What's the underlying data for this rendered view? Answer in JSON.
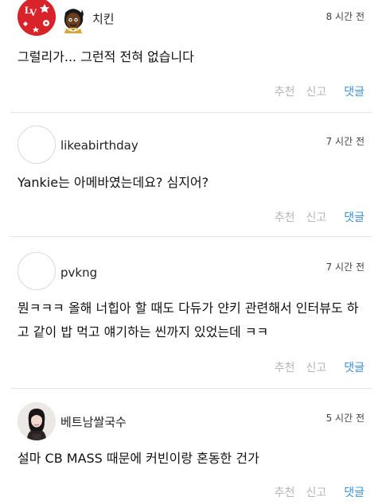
{
  "comments": [
    {
      "username": "치킨",
      "time": "8 시간 전",
      "text": "그럴리가... 그런적 전혀 없습니다",
      "avatar": "louis-vuitton-monogram-logo",
      "badge": "cartoon-character-icon"
    },
    {
      "username": "likeabirthday",
      "time": "7 시간 전",
      "text": "Yankie는 아메바였는데요? 심지어?",
      "avatar": "empty"
    },
    {
      "username": "pvkng",
      "time": "7 시간 전",
      "text": "뭔ㅋㅋㅋ 올해 너힙아 할 때도 다듀가 얀키 관련해서 인터뷰도 하고 같이 밥 먹고 얘기하는 씬까지 있었는데 ㅋㅋ",
      "avatar": "empty"
    },
    {
      "username": "베트남쌀국수",
      "time": "5 시간 전",
      "text": "설마 CB MASS 때문에 커빈이랑 혼동한 건가",
      "avatar": "woman-photo"
    }
  ],
  "actions": {
    "recommend": "추천",
    "report": "신고",
    "reply": "댓글"
  },
  "colors": {
    "reply": "#3a8fd6",
    "muted_action": "#b5b5b5",
    "divider": "#e4e4e4",
    "lv_red": "#d9232b"
  }
}
